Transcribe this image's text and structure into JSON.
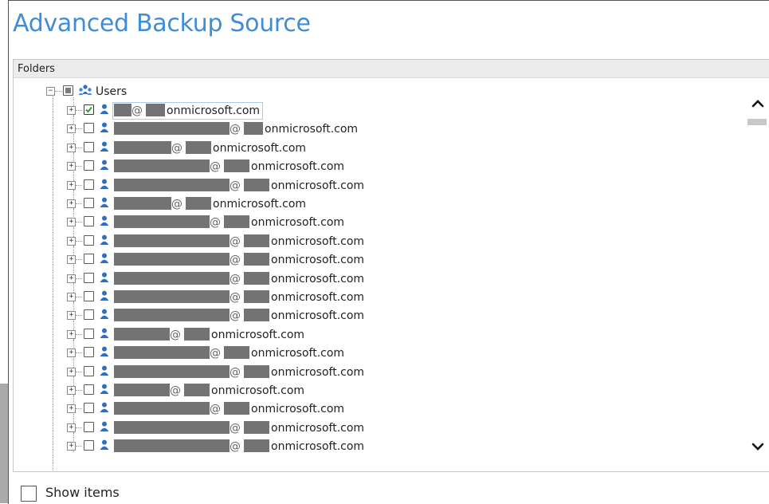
{
  "window": {
    "title": "Advanced Backup Source"
  },
  "tree": {
    "header": "Folders",
    "root": {
      "label": "Users",
      "state": "partial"
    },
    "domain_suffix": "onmicrosoft.com",
    "users": [
      {
        "label": "@ onmicrosoft.com",
        "checked": true,
        "selected": true
      },
      {
        "label": "@ onmicrosoft.com",
        "checked": false
      },
      {
        "label": "@ onmicrosoft.com",
        "checked": false
      },
      {
        "label": "@ onmicrosoft.com",
        "checked": false
      },
      {
        "label": "@ onmicrosoft.com",
        "checked": false
      },
      {
        "label": "@ onmicrosoft.com",
        "checked": false
      },
      {
        "label": "@ onmicrosoft.com",
        "checked": false
      },
      {
        "label": "@ onmicrosoft.com",
        "checked": false
      },
      {
        "label": "@ onmicrosoft.com",
        "checked": false
      },
      {
        "label": "@ onmicrosoft.com",
        "checked": false
      },
      {
        "label": "@ onmicrosoft.com",
        "checked": false
      },
      {
        "label": "@ onmicrosoft.com",
        "checked": false
      },
      {
        "label": "@ onmicrosoft.com",
        "checked": false
      },
      {
        "label": "@ onmicrosoft.com",
        "checked": false
      },
      {
        "label": "@ onmicrosoft.com",
        "checked": false
      },
      {
        "label": "@ onmicrosoft.com",
        "checked": false
      },
      {
        "label": "@ onmicrosoft.com",
        "checked": false
      },
      {
        "label": "@ onmicrosoft.com",
        "checked": false
      },
      {
        "label": "@ onmicrosoft.com",
        "checked": false
      }
    ]
  },
  "footer": {
    "show_items_label": "Show items",
    "show_items_checked": false
  },
  "colors": {
    "title": "#3f8dd8",
    "user_icon": "#2f6fc0",
    "redaction": "#737373",
    "check": "#2aa12a"
  },
  "icons": {
    "user": "user-icon",
    "group": "users-group-icon",
    "scroll_up": "chevron-up-icon",
    "scroll_down": "chevron-down-icon"
  }
}
